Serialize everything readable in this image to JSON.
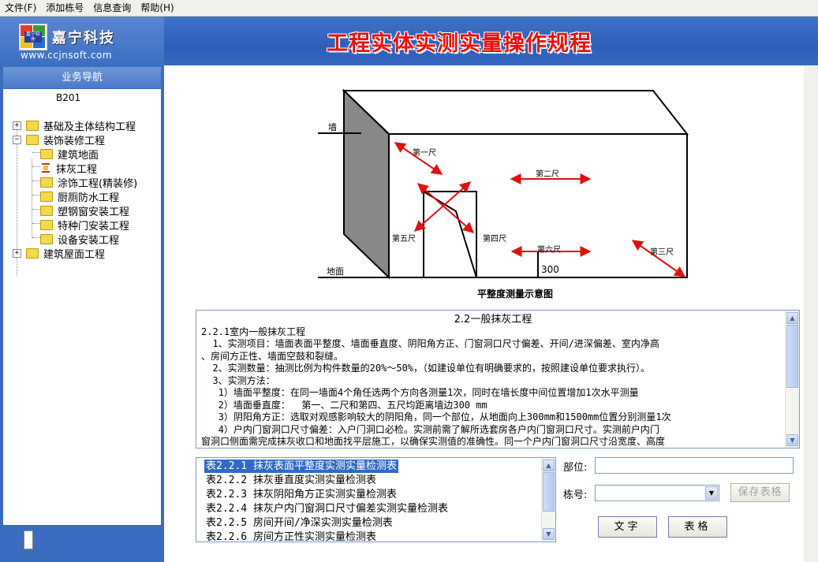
{
  "menu": [
    "文件(F)",
    "添加栋号",
    "信息查询",
    "帮助(H)"
  ],
  "header": {
    "company": "嘉宁科技",
    "badge": "嘉宁软件",
    "url": "www.ccjnsoft.com",
    "title": "工程实体实测实量操作规程"
  },
  "sidebar": {
    "nav_title": "业务导航",
    "root": "B201",
    "nodes": [
      {
        "label": "基础及主体结构工程",
        "expander": "+"
      },
      {
        "label": "装饰装修工程",
        "expander": "−"
      },
      {
        "label": "建筑地面"
      },
      {
        "label": "抹灰工程"
      },
      {
        "label": "涂饰工程(精装修)"
      },
      {
        "label": "厨厕防水工程"
      },
      {
        "label": "塑钢窗安装工程"
      },
      {
        "label": "特种门安装工程"
      },
      {
        "label": "设备安装工程"
      },
      {
        "label": "建筑屋面工程",
        "expander": "+"
      }
    ]
  },
  "diagram": {
    "wall": "墙",
    "ground": "地面",
    "r1": "第一尺",
    "r2": "第二尺",
    "r3": "第三尺",
    "r4": "第四尺",
    "r5": "第五尺",
    "r6": "第六尺",
    "dim": "300",
    "caption": "平整度测量示意图"
  },
  "doc": {
    "heading": "2.2一般抹灰工程",
    "lines": [
      "2.2.1室内一般抹灰工程",
      "  1、实测项目：墙面表面平整度、墙面垂直度、阴阳角方正、门窗洞口尺寸偏差、开间/进深偏差、室内净高",
      "、房间方正性、墙面空鼓和裂缝。",
      "  2、实测数量：抽测比例为构件数量的20%～50%，（如建设单位有明确要求的，按照建设单位要求执行）。",
      "  3、实测方法：",
      "   1）墙面平整度：在同一墙面4个角任选两个方向各测量1次，同时在墙长度中间位置增加1次水平测量",
      "   2）墙面垂直度：  第一、二尺和第四、五尺均距离墙边300 mm",
      "   3）阴阳角方正：选取对观感影响较大的阴阳角，同一个部位，从地面向上300mm和1500mm位置分别测量1次",
      "   4）户内门窗洞口尺寸偏差：入户门洞口必检。实测前需了解所选套房各户内门窗洞口尺寸。实测前户内门",
      "窗洞口侧面需完成抹灰收口和地面找平层施工，以确保实测值的准确性。同一个户内门窗洞口尺寸沿宽度、高度"
    ]
  },
  "tables": [
    "表2.2.1 抹灰表面平整度实测实量检测表",
    "表2.2.2 抹灰垂直度实测实量检测表",
    "表2.2.3 抹灰阴阳角方正实测实量检测表",
    "表2.2.4 抹灰户内门窗洞口尺寸偏差实测实量检测表",
    "表2.2.5 房间开间/净深实测实量检测表",
    "表2.2.6 房间方正性实测实量检测表"
  ],
  "form": {
    "location_label": "部位:",
    "location_value": "",
    "building_label": "栋号:",
    "building_value": "",
    "save_label": "保存表格",
    "text_label": "文字",
    "table_label": "表格"
  }
}
